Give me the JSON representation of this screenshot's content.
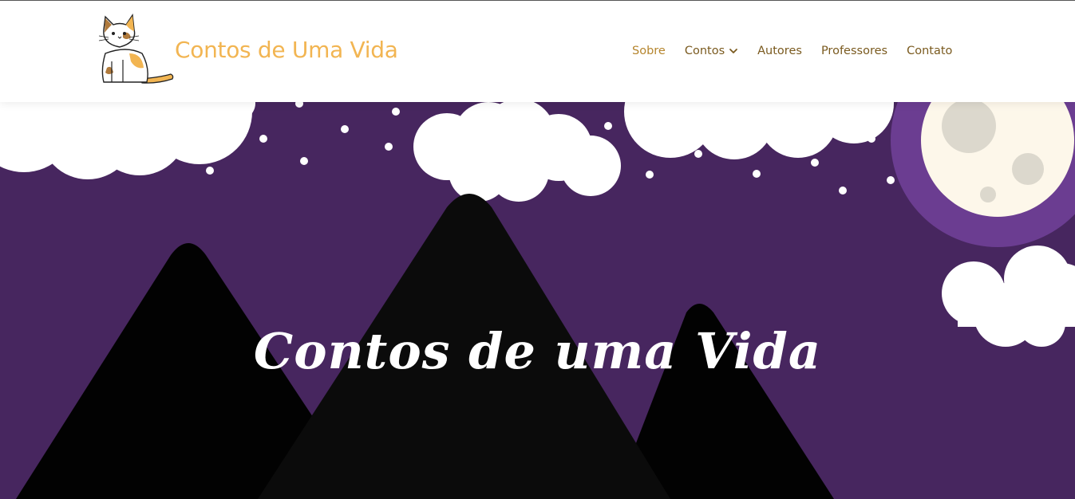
{
  "header": {
    "site_title": "Contos de Uma Vida",
    "logo_icon": "calico-cat-icon"
  },
  "nav": {
    "items": [
      {
        "label": "Sobre",
        "active": true
      },
      {
        "label": "Contos",
        "has_dropdown": true
      },
      {
        "label": "Autores"
      },
      {
        "label": "Professores"
      },
      {
        "label": "Contato"
      }
    ]
  },
  "hero": {
    "title": "Contos de uma Vida"
  },
  "colors": {
    "accent": "#f2b552",
    "nav_text": "#7a5a1f",
    "sky": "#47265f",
    "moon_ring": "#6d3f93",
    "moon": "#fdf7ea",
    "mountains": "#0a0a0a"
  }
}
